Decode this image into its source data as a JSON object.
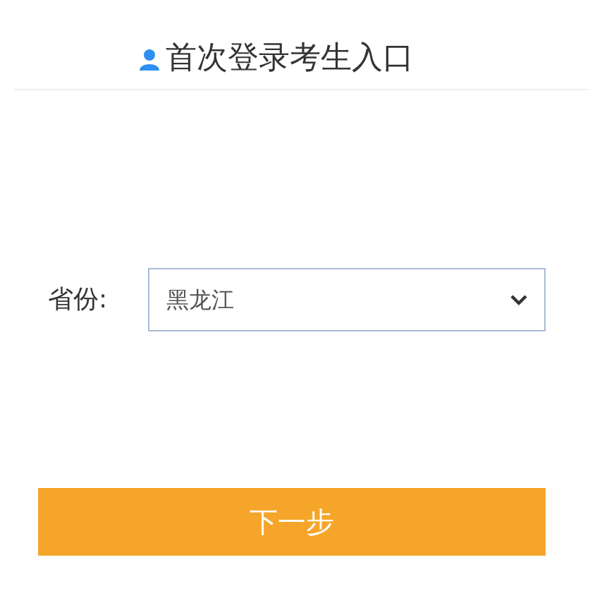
{
  "header": {
    "title": "首次登录考生入口"
  },
  "form": {
    "label": "省份:",
    "select": {
      "value": "黑龙江"
    }
  },
  "buttons": [
    "下一步"
  ]
}
